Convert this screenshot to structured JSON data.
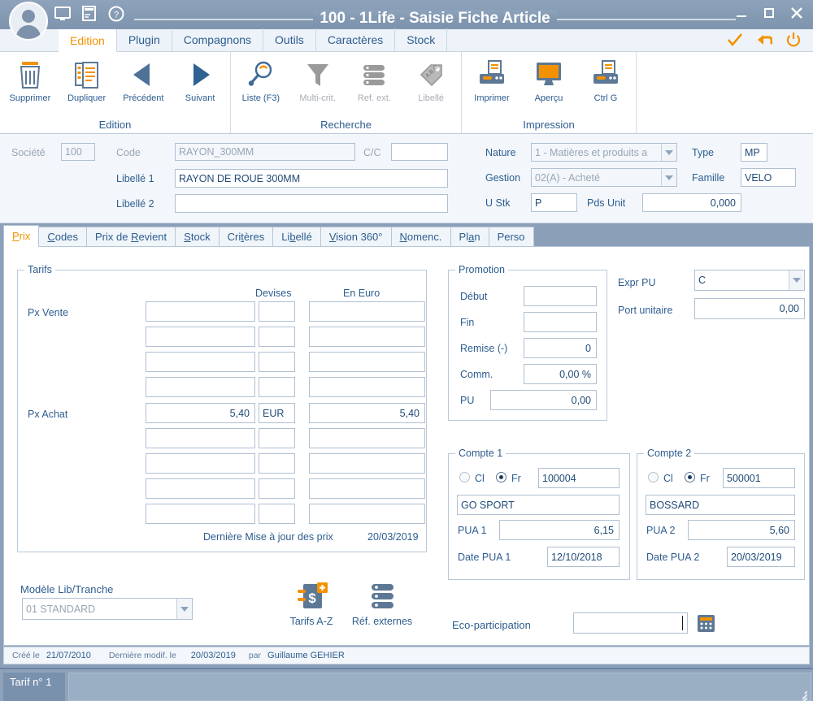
{
  "window": {
    "title": "100 - 1Life - Saisie Fiche Article",
    "quick_icons": [
      "monitor-icon",
      "note-icon",
      "help-icon"
    ],
    "controls": [
      "minimize-button",
      "maximize-button",
      "close-button"
    ]
  },
  "ribbon": {
    "tabs": [
      {
        "label": "Edition",
        "active": true
      },
      {
        "label": "Plugin",
        "active": false
      },
      {
        "label": "Compagnons",
        "active": false
      },
      {
        "label": "Outils",
        "active": false
      },
      {
        "label": "Caractères",
        "active": false
      },
      {
        "label": "Stock",
        "active": false
      }
    ],
    "right_actions": [
      "validate-check-icon",
      "undo-arrow-icon",
      "power-icon"
    ],
    "groups": [
      {
        "name": "Edition",
        "items": [
          {
            "label": "Supprimer",
            "icon": "trash-icon",
            "disabled": false
          },
          {
            "label": "Dupliquer",
            "icon": "duplicate-document-icon",
            "disabled": false
          },
          {
            "label": "Précédent",
            "icon": "previous-triangle-icon",
            "disabled": false
          },
          {
            "label": "Suivant",
            "icon": "next-triangle-icon",
            "disabled": false
          }
        ]
      },
      {
        "name": "Recherche",
        "items": [
          {
            "label": "Liste (F3)",
            "icon": "magnifier-icon",
            "disabled": false
          },
          {
            "label": "Multi-crit.",
            "icon": "funnel-icon",
            "disabled": true
          },
          {
            "label": "Ref. ext.",
            "icon": "database-icon",
            "disabled": true
          },
          {
            "label": "Libellé",
            "icon": "abc-tag-icon",
            "disabled": true
          }
        ]
      },
      {
        "name": "Impression",
        "items": [
          {
            "label": "Imprimer",
            "icon": "printer-icon",
            "disabled": false
          },
          {
            "label": "Aperçu",
            "icon": "preview-monitor-icon",
            "disabled": false
          },
          {
            "label": "Ctrl G",
            "icon": "printer-alt-icon",
            "disabled": false
          }
        ]
      }
    ]
  },
  "header": {
    "societe_label": "Société",
    "societe_value": "100",
    "code_label": "Code",
    "code_value": "RAYON_300MM",
    "cc_label": "C/C",
    "cc_value": "",
    "libelle1_label": "Libellé 1",
    "libelle1_value": "RAYON DE ROUE 300MM",
    "libelle2_label": "Libellé 2",
    "libelle2_value": "",
    "nature_label": "Nature",
    "nature_value": "1 - Matières et produits a",
    "type_label": "Type",
    "type_value": "MP",
    "gestion_label": "Gestion",
    "gestion_value": "02(A) - Acheté",
    "famille_label": "Famille",
    "famille_value": "VELO",
    "ustk_label": "U Stk",
    "ustk_value": "P",
    "pdsunit_label": "Pds Unit",
    "pdsunit_value": "0,000"
  },
  "tabs": [
    {
      "label": "Prix",
      "accel": "P",
      "active": true
    },
    {
      "label": "Codes",
      "accel": "C",
      "active": false
    },
    {
      "label": "Prix de Revient",
      "accel": "R",
      "active": false
    },
    {
      "label": "Stock",
      "accel": "S",
      "active": false
    },
    {
      "label": "Critères",
      "accel": "t",
      "active": false
    },
    {
      "label": "Libellé",
      "accel": "b",
      "active": false
    },
    {
      "label": "Vision 360°",
      "accel": "V",
      "active": false
    },
    {
      "label": "Nomenc.",
      "accel": "N",
      "active": false
    },
    {
      "label": "Plan",
      "accel": "a",
      "active": false
    },
    {
      "label": "Perso",
      "accel": "",
      "active": false
    }
  ],
  "tarifs": {
    "title": "Tarifs",
    "col_devises": "Devises",
    "col_eneuro": "En Euro",
    "px_vente_label": "Px Vente",
    "px_achat_label": "Px Achat",
    "vente_rows": [
      {
        "montant": "",
        "devise": "",
        "euro": ""
      },
      {
        "montant": "",
        "devise": "",
        "euro": ""
      },
      {
        "montant": "",
        "devise": "",
        "euro": ""
      },
      {
        "montant": "",
        "devise": "",
        "euro": ""
      }
    ],
    "achat_rows": [
      {
        "montant": "5,40",
        "devise": "EUR",
        "euro": "5,40"
      },
      {
        "montant": "",
        "devise": "",
        "euro": ""
      },
      {
        "montant": "",
        "devise": "",
        "euro": ""
      },
      {
        "montant": "",
        "devise": "",
        "euro": ""
      },
      {
        "montant": "",
        "devise": "",
        "euro": ""
      }
    ],
    "last_update_label": "Dernière Mise à jour des prix",
    "last_update_value": "20/03/2019"
  },
  "promotion": {
    "title": "Promotion",
    "debut_label": "Début",
    "debut_value": "",
    "fin_label": "Fin",
    "fin_value": "",
    "remise_label": "Remise (-)",
    "remise_value": "0",
    "comm_label": "Comm.",
    "comm_value": "0,00 %",
    "pu_label": "PU",
    "pu_value": "0,00"
  },
  "expr": {
    "expr_pu_label": "Expr PU",
    "expr_pu_value": "C",
    "port_unitaire_label": "Port unitaire",
    "port_unitaire_value": "0,00"
  },
  "compte1": {
    "title": "Compte 1",
    "radio_cl_label": "Cl",
    "radio_fr_label": "Fr",
    "selected": "Fr",
    "numero": "100004",
    "nom": "GO SPORT",
    "pua_label": "PUA 1",
    "pua_value": "6,15",
    "date_pua_label": "Date PUA 1",
    "date_pua_value": "12/10/2018"
  },
  "compte2": {
    "title": "Compte 2",
    "radio_cl_label": "Cl",
    "radio_fr_label": "Fr",
    "selected": "Fr",
    "numero": "500001",
    "nom": "BOSSARD",
    "pua_label": "PUA 2",
    "pua_value": "5,60",
    "date_pua_label": "Date PUA 2",
    "date_pua_value": "20/03/2019"
  },
  "bottom": {
    "modele_label": "Modèle Lib/Tranche",
    "modele_value": "01 STANDARD",
    "tarifs_az_label": "Tarifs A-Z",
    "ref_externes_label": "Réf. externes",
    "eco_label": "Eco-participation",
    "eco_value": "",
    "calculator_icon": "calculator-icon"
  },
  "meta": {
    "cree_le_label": "Créé le",
    "cree_le_value": "21/07/2010",
    "modif_label": "Dernière modif. le",
    "modif_value": "20/03/2019",
    "par_label": "par",
    "par_value": "Guillaume GEHIER"
  },
  "statusbar": {
    "tarif_label": "Tarif n° 1"
  },
  "colors": {
    "accent_orange": "#f39200",
    "blue_text": "#2d5d8f",
    "chrome_blue": "#8ea3bb",
    "icon_slate": "#5d7894"
  }
}
